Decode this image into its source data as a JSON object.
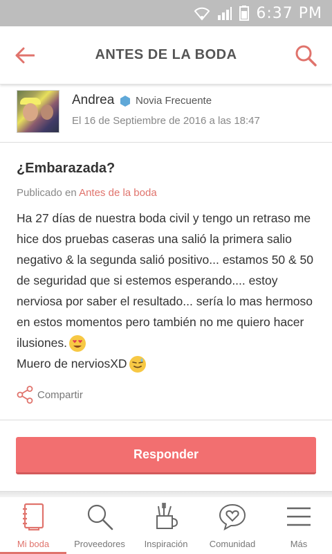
{
  "status_bar": {
    "time": "6:37 PM"
  },
  "header": {
    "title": "ANTES DE LA BODA"
  },
  "author": {
    "name": "Andrea",
    "badge": "Novia Frecuente",
    "date": "El 16 de Septiembre de 2016 a las 18:47"
  },
  "post": {
    "title": "¿Embarazada?",
    "published_prefix": "Publicado en",
    "category": "Antes de la boda",
    "body_line1": "Ha 27 días de nuestra boda civil y tengo un retraso me hice dos pruebas caseras una salió la primera salio negativo & la segunda salió positivo... estamos 50 & 50 de seguridad que si estemos esperando.... estoy nerviosa por saber el resultado... sería lo mas hermoso en estos momentos pero también no me quiero hacer ilusiones.",
    "body_line2": "Muero de nerviosXD",
    "share_label": "Compartir"
  },
  "actions": {
    "respond_label": "Responder"
  },
  "bottom_nav": {
    "items": [
      {
        "label": "Mi boda",
        "icon": "notebook-icon",
        "active": true
      },
      {
        "label": "Proveedores",
        "icon": "search-icon",
        "active": false
      },
      {
        "label": "Inspiración",
        "icon": "tools-cup-icon",
        "active": false
      },
      {
        "label": "Comunidad",
        "icon": "heart-chat-icon",
        "active": false
      },
      {
        "label": "Más",
        "icon": "menu-icon",
        "active": false
      }
    ]
  },
  "colors": {
    "accent": "#e0736c",
    "button": "#f26f70",
    "status_bar": "#bdbdbd"
  }
}
